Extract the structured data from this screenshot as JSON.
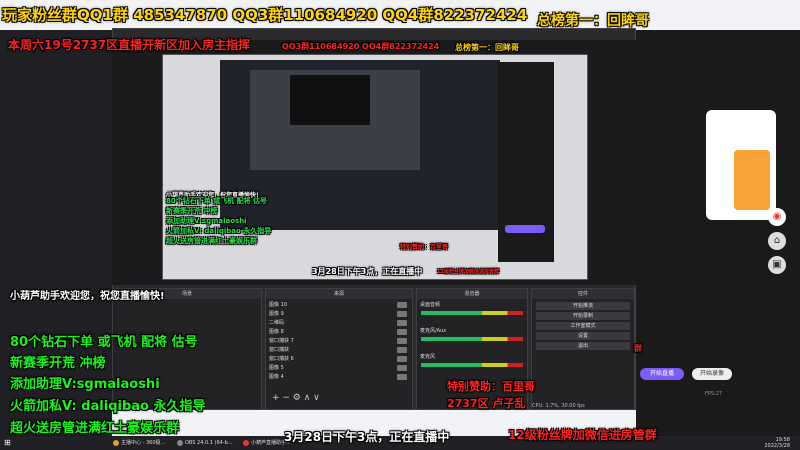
{
  "overlay": {
    "fans_groups": "玩家粉丝群QQ1群 485347870 QQ3群110684920 QQ4群822372424",
    "top_rank": "总榜第一：回眸哥",
    "notice": "本周六19号2737区直播开新区加入房主指挥",
    "notice_tail": "QQ3群110684920 QQ4群822372424",
    "welcome": "小葫芦助手欢迎您，祝您直播愉快!",
    "promo_lines": [
      "80个钻石下单 或飞机  配将  估号",
      "新赛季开荒  冲榜",
      "添加助理V:sgmalaoshi",
      "火箭加私V: daliqibao 永久指导",
      "超火送房管进满红土豪娱乐群"
    ],
    "sponsor_line1": "特别赞助：百里哥",
    "sponsor_line2": "2737区    卢子乱",
    "date_live": "3月28日下午3点，正在直播中",
    "fan_badge": "12级粉丝牌加微信进房管群",
    "red_qun": "群"
  },
  "obs": {
    "scenes_header": "场景",
    "sources_header": "来源",
    "mixer_header": "混音器",
    "controls_header": "控件",
    "sources": [
      "图像 10",
      "图像 9",
      "二维码",
      "图像 8",
      "窗口捕获 7",
      "窗口捕获",
      "窗口捕获 6",
      "图像 5",
      "图像 4"
    ],
    "mixer_labels": [
      "桌面音频",
      "麦克风/Aux",
      "麦克风"
    ],
    "controls": [
      "开始推流",
      "开始录制",
      "工作室模式",
      "设置",
      "退出"
    ],
    "status": "CPU: 1.7%, 30.00 fps"
  },
  "right_side": {
    "start_live": "开始直播",
    "start_record": "开始录像",
    "fps": "FPS:27"
  },
  "taskbar": {
    "items": [
      "主播中心 - 360极...",
      "OBS 24.0.1 (64-b...",
      "小葫芦直播助手..."
    ],
    "time": "19:58",
    "date": "2022/3/28"
  },
  "colors": {
    "accent_yellow": "#ffd400",
    "accent_red": "#ff2020",
    "accent_green": "#22e24a",
    "obs_bg": "#2b2b2e"
  }
}
